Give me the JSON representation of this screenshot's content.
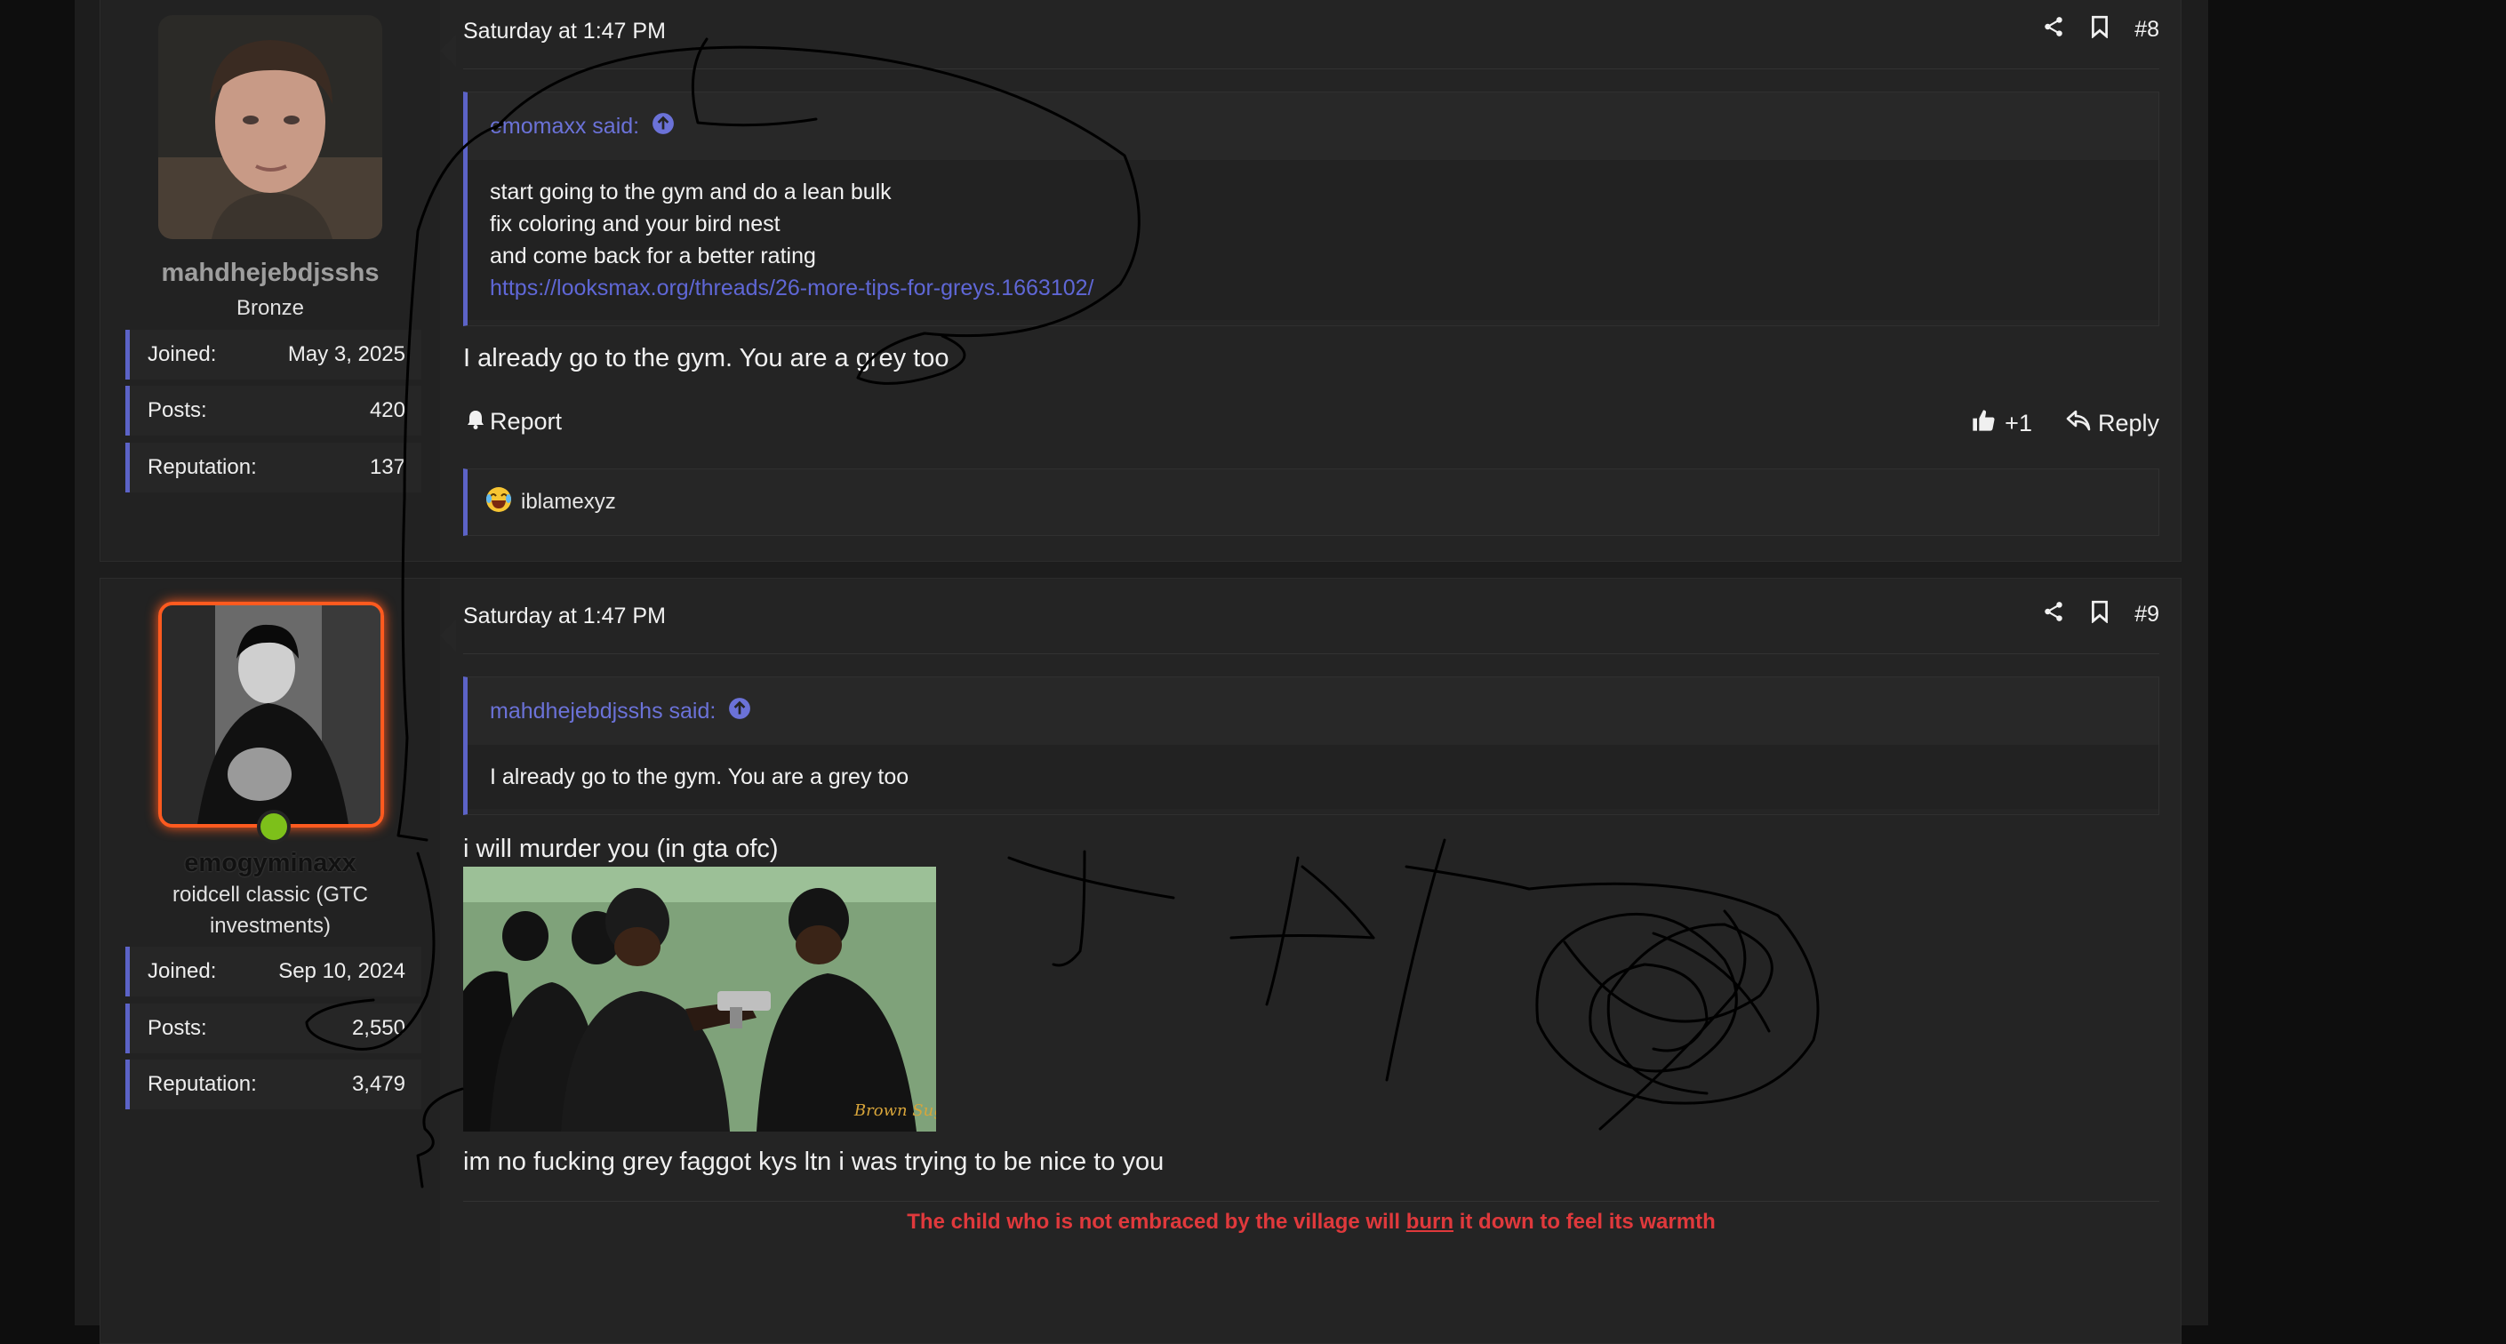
{
  "posts": [
    {
      "author": "mahdhejebdjsshs",
      "title": "Bronze",
      "stats": [
        {
          "label": "Joined:",
          "value": "May 3, 2025"
        },
        {
          "label": "Posts:",
          "value": "420"
        },
        {
          "label": "Reputation:",
          "value": "137"
        }
      ],
      "datetime": "Saturday at 1:47 PM",
      "number": "#8",
      "quote": {
        "author_label": "emomaxx said:",
        "lines": [
          "start going to the gym and do a lean bulk",
          "fix coloring and your bird nest",
          "and come back for a better rating"
        ],
        "link": "https://looksmax.org/threads/26-more-tips-for-greys.1663102/"
      },
      "message": "I already go to the gym. You are a grey too",
      "report_label": "Report",
      "like_count": "+1",
      "reply_label": "Reply",
      "reaction_user": "iblamexyz"
    },
    {
      "author": "emogyminaxx",
      "title": "roidcell classic (GTC investments)",
      "stats": [
        {
          "label": "Joined:",
          "value": "Sep 10, 2024"
        },
        {
          "label": "Posts:",
          "value": "2,550"
        },
        {
          "label": "Reputation:",
          "value": "3,479"
        }
      ],
      "datetime": "Saturday at 1:47 PM",
      "number": "#9",
      "quote": {
        "author_label": "mahdhejebdjsshs said:",
        "text": "I already go to the gym. You are a grey too"
      },
      "message_1": "i will murder you (in gta ofc)",
      "gif_watermark": "Brown Sugar",
      "message_2": "im no fucking grey faggot kys ltn i was trying to be nice to you",
      "signature": {
        "before": "The child who is not embraced by the village will ",
        "emph": "burn",
        "after": " it down to feel its warmth"
      }
    }
  ],
  "colors": {
    "accent": "#5c63c7",
    "link": "#5f67d6",
    "signature": "#e0393c",
    "online": "#7dc01a",
    "avatar_ring": "#ff5a1f"
  }
}
